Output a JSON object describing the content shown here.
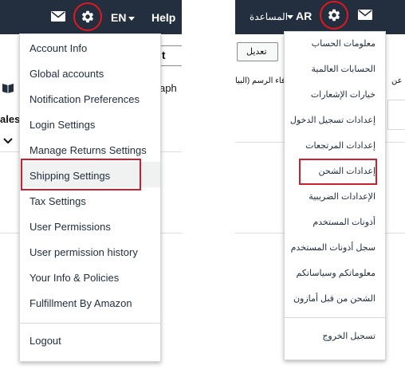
{
  "colors": {
    "nav_bg": "#232f3e",
    "highlight_border": "#cc1f2f",
    "gear_ring": "#e3171d",
    "menu_text": "#232f3e"
  },
  "english": {
    "nav": {
      "language": "EN",
      "help": "Help",
      "icons": [
        "mail-icon",
        "gear-icon",
        "chevron-down-icon"
      ]
    },
    "background": {
      "button_fragment": "it",
      "text_fragment_graph": "aph",
      "text_fragment_sales": "ales",
      "icon": "book-icon"
    },
    "menu": {
      "items": [
        "Account Info",
        "Global accounts",
        "Notification Preferences",
        "Login Settings",
        "Manage Returns Settings",
        "Shipping Settings",
        "Tax Settings",
        "User Permissions",
        "User permission history",
        "Your Info & Policies",
        "Fulfillment By Amazon"
      ],
      "logout": "Logout",
      "highlighted": "Shipping Settings"
    }
  },
  "arabic": {
    "nav": {
      "help": "المساعدة",
      "language": "AR",
      "icons": [
        "gear-icon",
        "mail-icon",
        "chevron-down-icon"
      ]
    },
    "background": {
      "edit_button": "تعديل",
      "text_fragment": "عن",
      "text_fragment_2": "فاء الرسم (البيا"
    },
    "menu": {
      "items": [
        "معلومات الحساب",
        "الحسابات العالمية",
        "خيارات الإشعارات",
        "إعدادات تسجيل الدخول",
        "إعدادات المرتجعات",
        "إعدادات الشحن",
        "الإعدادات الضريبية",
        "أذونات المستخدم",
        "سجل أذونات المستخدم",
        "معلوماتكم وسياساتكم",
        "الشحن من قبل أمازون"
      ],
      "logout": "تسجيل الخروج",
      "highlighted": "إعدادات الشحن"
    }
  }
}
